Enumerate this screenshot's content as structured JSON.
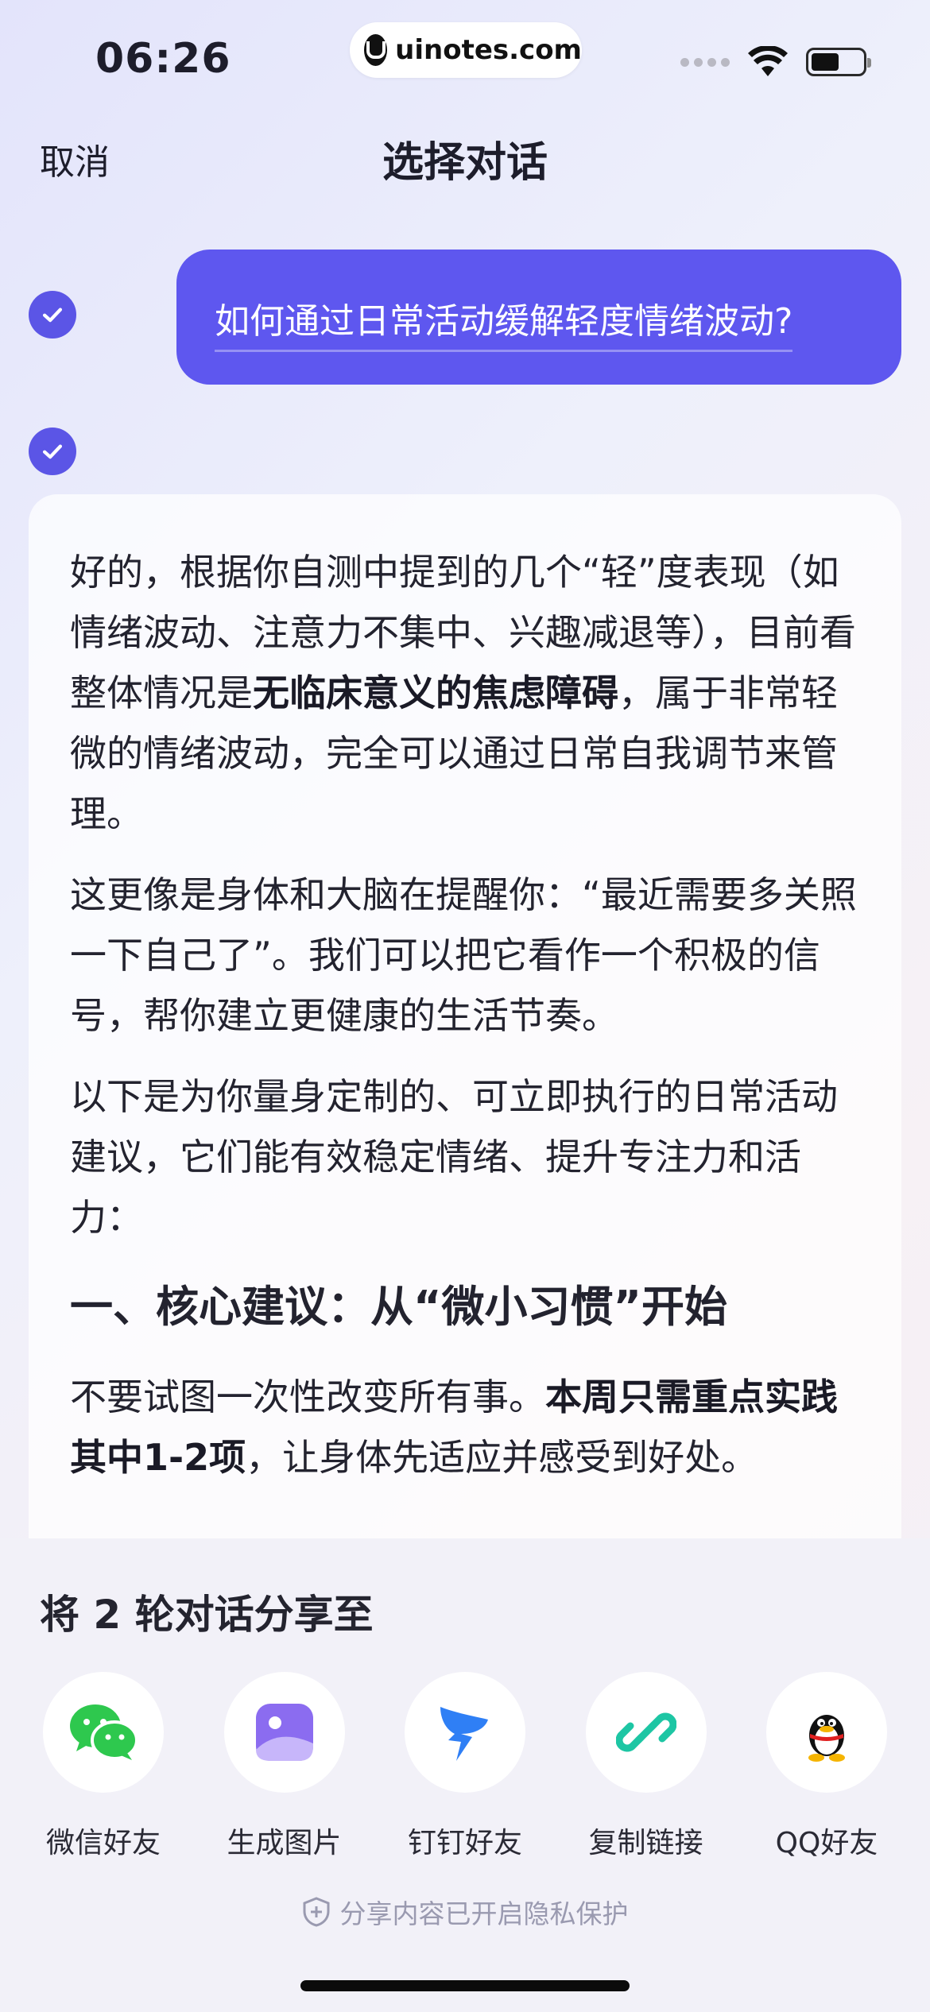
{
  "status_bar": {
    "time": "06:26",
    "url": "uinotes.com",
    "icons": [
      "signal-dots-icon",
      "wifi-icon",
      "battery-icon"
    ]
  },
  "nav": {
    "cancel": "取消",
    "title": "选择对话"
  },
  "question": {
    "text": "如何通过日常活动缓解轻度情绪波动?"
  },
  "answer": {
    "p1_a": "好的，根据你自测中提到的几个“轻”度表现（如情绪波动、注意力不集中、兴趣减退等），目前看整体情况是",
    "p1_b": "无临床意义的焦虑障碍",
    "p1_c": "，属于非常轻微的情绪波动，完全可以通过日常自我调节来管理。",
    "p2": "这更像是身体和大脑在提醒你：“最近需要多关照一下自己了”。我们可以把它看作一个积极的信号，帮你建立更健康的生活节奏。",
    "p3": "以下是为你量身定制的、可立即执行的日常活动建议，它们能有效稳定情绪、提升专注力和活力：",
    "heading": "一、核心建议：从“微小习惯”开始",
    "p4_a": "不要试图一次性改变所有事。",
    "p4_b": "本周只需重点实践其中1-2项",
    "p4_c": "，让身体先适应并感受到好处。"
  },
  "share": {
    "title": "将 2 轮对话分享至",
    "items": [
      {
        "label": "微信好友",
        "icon": "wechat-icon"
      },
      {
        "label": "生成图片",
        "icon": "image-icon"
      },
      {
        "label": "钉钉好友",
        "icon": "dingtalk-icon"
      },
      {
        "label": "复制链接",
        "icon": "link-icon"
      },
      {
        "label": "QQ好友",
        "icon": "qq-icon"
      }
    ],
    "privacy": "分享内容已开启隐私保护"
  },
  "colors": {
    "accent": "#5e57ef",
    "check": "#5b55e6",
    "wechat": "#2ec84e",
    "image": "#8b6cf0",
    "dingtalk": "#2f7ff5",
    "link": "#1dc6a4"
  }
}
